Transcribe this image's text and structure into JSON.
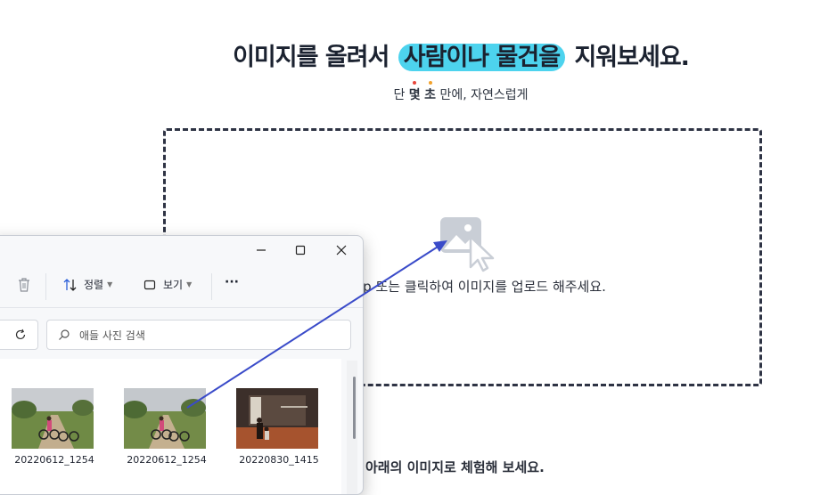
{
  "page": {
    "headline_before": "이미지를 올려서",
    "headline_highlight": "사람이나 물건을",
    "headline_after": "지워보세요.",
    "sub_a": "단",
    "sub_b": "몇",
    "sub_c": "초",
    "sub_rest": "만에, 자연스럽게",
    "drop_text": "op 또는 클릭하여 이미지를 업로드 해주세요.",
    "trial_text": "아래의 이미지로 체험해 보세요.",
    "colors": {
      "highlight": "#4dd3ee",
      "dot_red": "#e8463a",
      "dot_orange": "#f2a22c",
      "arrow": "#3a4bc9"
    }
  },
  "explorer": {
    "sort_label": "정렬",
    "view_label": "보기",
    "more_label": "···",
    "search_placeholder": "애들 사진 검색",
    "files": [
      {
        "name": "20220612_1254"
      },
      {
        "name": "20220612_1254"
      },
      {
        "name": "20220830_1415"
      }
    ]
  }
}
